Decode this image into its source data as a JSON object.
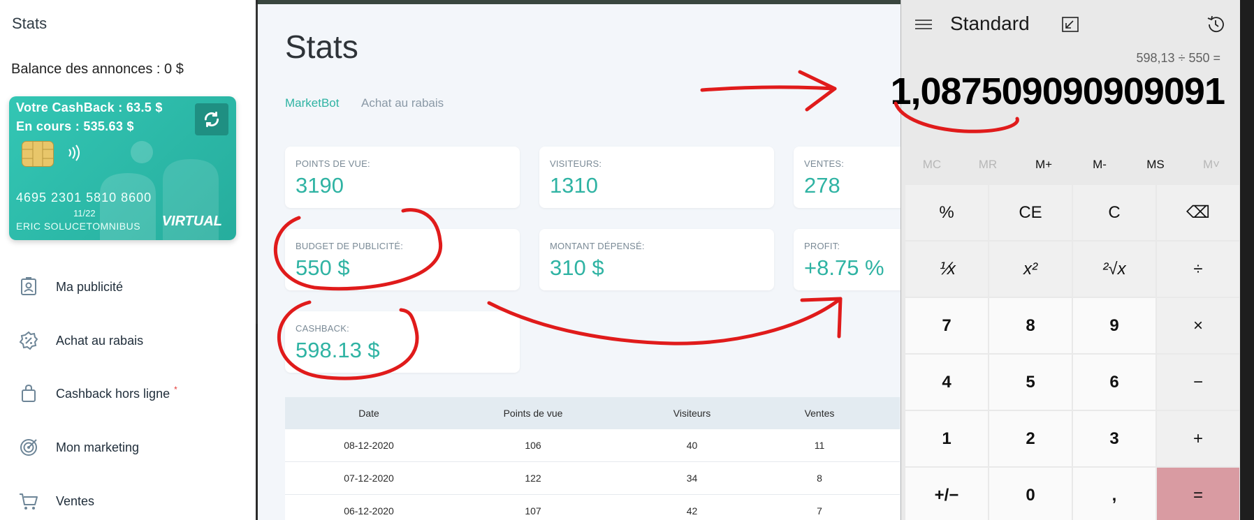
{
  "sidebar": {
    "title": "Stats",
    "balance": "Balance des annonces : 0 $",
    "card": {
      "cashback": "Votre CashBack : 63.5 $",
      "in_progress": "En cours : 535.63 $",
      "number": "4695 2301 5810 8600",
      "expiry": "11/22",
      "holder": "ERIC SOLUCETOMNIBUS",
      "type": "VIRTUAL"
    },
    "nav": [
      {
        "label": "Ma publicité",
        "icon": "id-badge-icon"
      },
      {
        "label": "Achat au rabais",
        "icon": "discount-badge-icon"
      },
      {
        "label": "Cashback hors ligne",
        "icon": "shopping-bag-icon",
        "badge": "*"
      },
      {
        "label": "Mon marketing",
        "icon": "target-icon"
      },
      {
        "label": "Ventes",
        "icon": "cart-icon"
      }
    ]
  },
  "main": {
    "title": "Stats",
    "tabs": [
      "MarketBot",
      "Achat au rabais"
    ],
    "stats": [
      {
        "label": "POINTS DE VUE:",
        "value": "3190"
      },
      {
        "label": "VISITEURS:",
        "value": "1310"
      },
      {
        "label": "VENTES:",
        "value": "278"
      },
      {
        "label": "BUDGET DE PUBLICITÉ:",
        "value": "550 $"
      },
      {
        "label": "MONTANT DÉPENSÉ:",
        "value": "310 $"
      },
      {
        "label": "PROFIT:",
        "value": "+8.75 %"
      },
      {
        "label": "CASHBACK:",
        "value": "598.13 $"
      }
    ],
    "table": {
      "headers": [
        "Date",
        "Points de vue",
        "Visiteurs",
        "Ventes"
      ],
      "rows": [
        [
          "08-12-2020",
          "106",
          "40",
          "11"
        ],
        [
          "07-12-2020",
          "122",
          "34",
          "8"
        ],
        [
          "06-12-2020",
          "107",
          "42",
          "7"
        ]
      ]
    }
  },
  "calculator": {
    "mode": "Standard",
    "expression": "598,13 ÷ 550 =",
    "result": "1,087509090909091",
    "memory": [
      "MC",
      "MR",
      "M+",
      "M-",
      "MS",
      "M˅"
    ],
    "keys": [
      [
        "%",
        "CE",
        "C",
        "⌫"
      ],
      [
        "⅟x",
        "x²",
        "²√x",
        "÷"
      ],
      [
        "7",
        "8",
        "9",
        "×"
      ],
      [
        "4",
        "5",
        "6",
        "−"
      ],
      [
        "1",
        "2",
        "3",
        "+"
      ],
      [
        "+/−",
        "0",
        ",",
        "="
      ]
    ],
    "accent": "#d99ba2"
  },
  "colors": {
    "teal": "#2fb3a3",
    "annotation_red": "#e01b1b"
  }
}
